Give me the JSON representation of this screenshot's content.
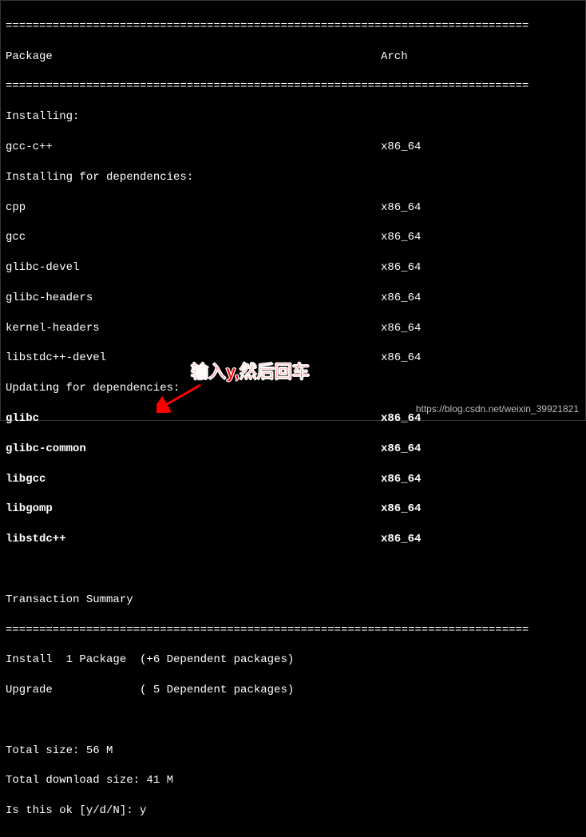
{
  "divider": "==============================================================================",
  "header": {
    "package": "Package",
    "arch": "Arch"
  },
  "sections": {
    "installing_label": "Installing:",
    "installing_deps_label": "Installing for dependencies:",
    "updating_deps_label": "Updating for dependencies:"
  },
  "installing": [
    {
      "name": "gcc-c++",
      "arch": "x86_64"
    }
  ],
  "installing_deps": [
    {
      "name": "cpp",
      "arch": "x86_64"
    },
    {
      "name": "gcc",
      "arch": "x86_64"
    },
    {
      "name": "glibc-devel",
      "arch": "x86_64"
    },
    {
      "name": "glibc-headers",
      "arch": "x86_64"
    },
    {
      "name": "kernel-headers",
      "arch": "x86_64"
    },
    {
      "name": "libstdc++-devel",
      "arch": "x86_64"
    }
  ],
  "updating_deps": [
    {
      "name": "glibc",
      "arch": "x86_64"
    },
    {
      "name": "glibc-common",
      "arch": "x86_64"
    },
    {
      "name": "libgcc",
      "arch": "x86_64"
    },
    {
      "name": "libgomp",
      "arch": "x86_64"
    },
    {
      "name": "libstdc++",
      "arch": "x86_64"
    }
  ],
  "summary": {
    "title": "Transaction Summary",
    "install_line": "Install  1 Package  (+6 Dependent packages)",
    "upgrade_line": "Upgrade             ( 5 Dependent packages)",
    "total_size": "Total size: 56 M",
    "total_download": "Total download size: 41 M",
    "prompt": "Is this ok [y/d/N]: ",
    "input_value": "y"
  },
  "annotation_text": "输入y,然后回车",
  "watermark": "https://blog.csdn.net/weixin_39921821"
}
